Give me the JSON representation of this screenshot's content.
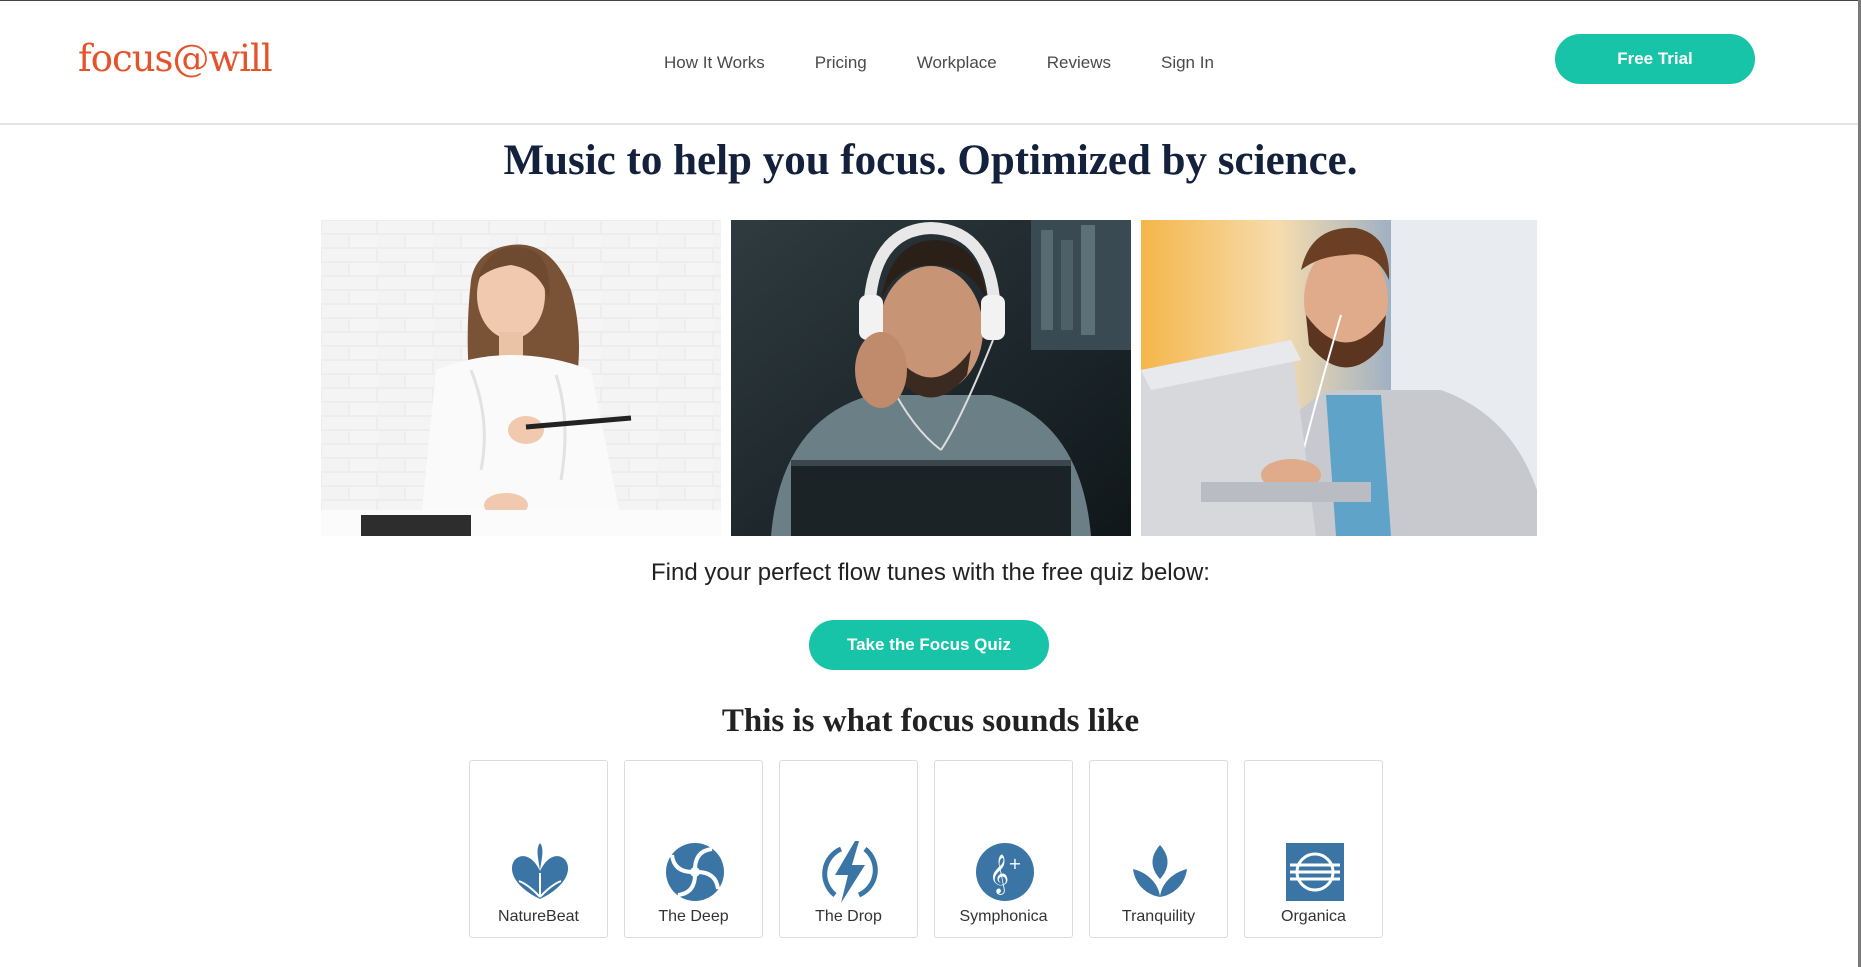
{
  "header": {
    "logo": "focus@will",
    "nav": [
      "How It Works",
      "Pricing",
      "Workplace",
      "Reviews",
      "Sign In"
    ],
    "cta": "Free Trial"
  },
  "hero": {
    "headline": "Music to help you focus. Optimized by science.",
    "quiz_text": "Find your perfect flow tunes with the free quiz below:",
    "quiz_button": "Take the Focus Quiz"
  },
  "sounds": {
    "title": "This is what focus sounds like",
    "channels": [
      {
        "label": "NatureBeat",
        "icon": "heart-leaves-icon"
      },
      {
        "label": "The Deep",
        "icon": "swirl-icon"
      },
      {
        "label": "The Drop",
        "icon": "lightning-icon"
      },
      {
        "label": "Symphonica",
        "icon": "treble-clef-icon"
      },
      {
        "label": "Tranquility",
        "icon": "lotus-icon"
      },
      {
        "label": "Organica",
        "icon": "globe-icon"
      }
    ]
  },
  "colors": {
    "accent": "#18c4a7",
    "logo": "#e5532b",
    "headline": "#14213d",
    "icon": "#3a75a6"
  }
}
